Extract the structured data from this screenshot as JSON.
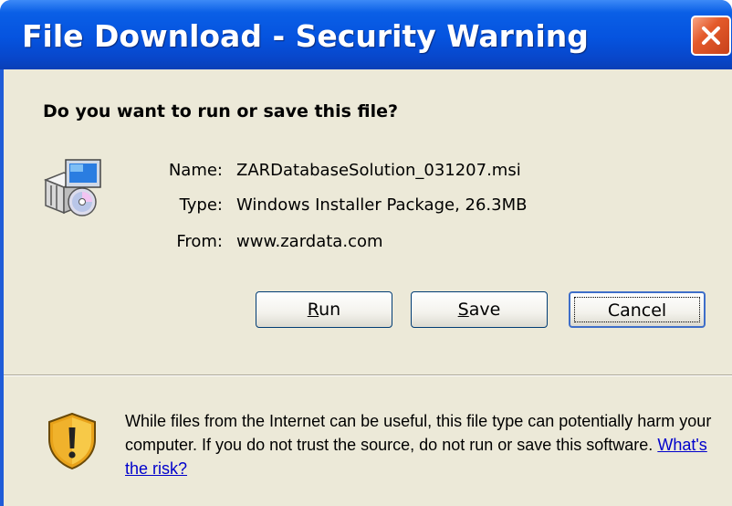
{
  "window": {
    "title": "File Download - Security Warning",
    "close_icon": "close-icon",
    "colors": {
      "titlebar": "#0553df",
      "close": "#e45a2b",
      "client": "#ece9d8"
    }
  },
  "dialog": {
    "question": "Do you want to run or save this file?",
    "file_icon": "installer-package-icon",
    "file_info": [
      {
        "label": "Name:",
        "value": "ZARDatabaseSolution_031207.msi"
      },
      {
        "label": "Type:",
        "value": "Windows Installer Package, 26.3MB"
      },
      {
        "label": "From:",
        "value": "www.zardata.com"
      }
    ],
    "buttons": {
      "run": {
        "accel": "R",
        "rest": "un"
      },
      "save": {
        "accel": "S",
        "rest": "ave"
      },
      "cancel": {
        "label": "Cancel"
      }
    },
    "warning": {
      "icon": "shield-warning-icon",
      "text": "While files from the Internet can be useful, this file type can potentially harm your computer. If you do not trust the source, do not run or save this software.",
      "link": "What's the risk?"
    }
  }
}
